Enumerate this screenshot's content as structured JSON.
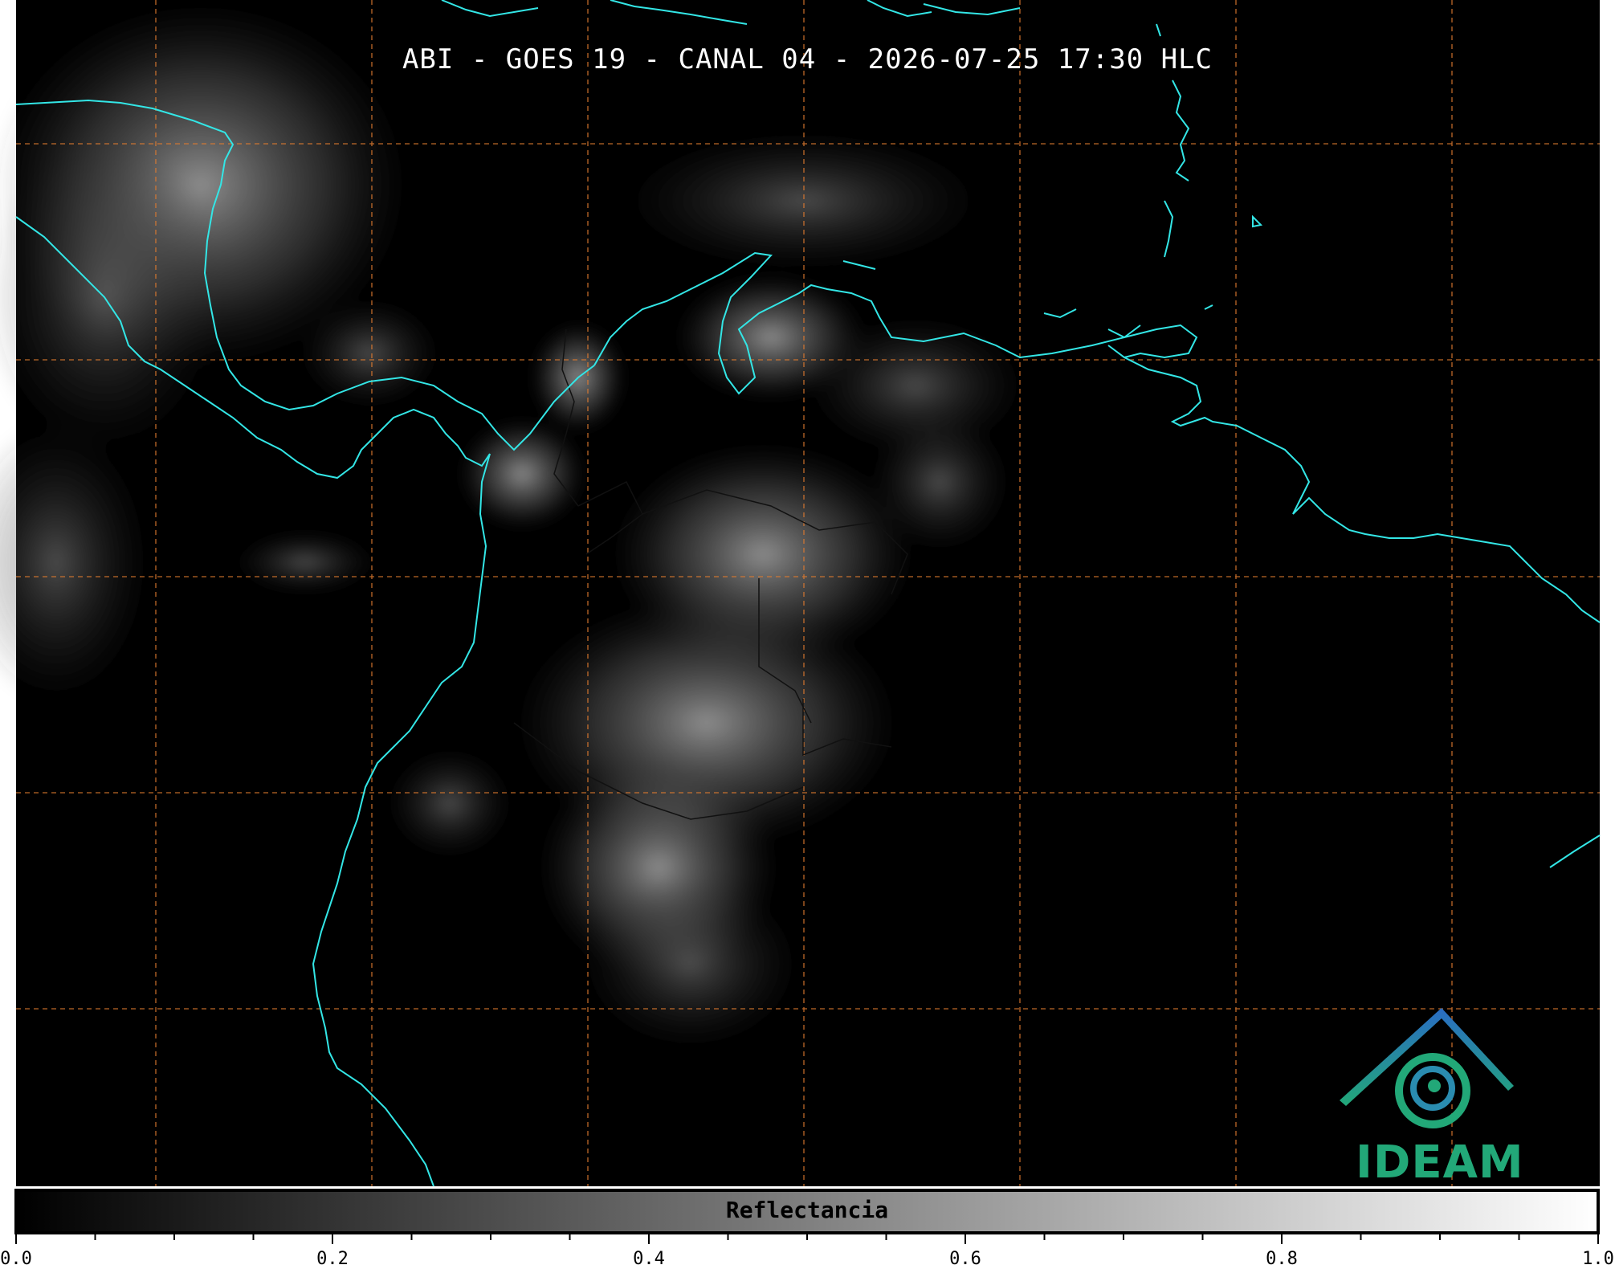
{
  "title": "ABI - GOES 19 - CANAL 04 - 2026-07-25 17:30 HLC",
  "colorbar": {
    "label": "Reflectancia",
    "ticks": [
      "0.0",
      "0.2",
      "0.4",
      "0.6",
      "0.8",
      "1.0"
    ],
    "range": [
      0.0,
      1.0
    ]
  },
  "logo": {
    "text": "IDEAM"
  },
  "colors": {
    "coastline": "#33e6e6",
    "gridline": "#e07b2f",
    "background": "#000000",
    "logo_blue": "#2a6cc4",
    "logo_green": "#22a878"
  }
}
